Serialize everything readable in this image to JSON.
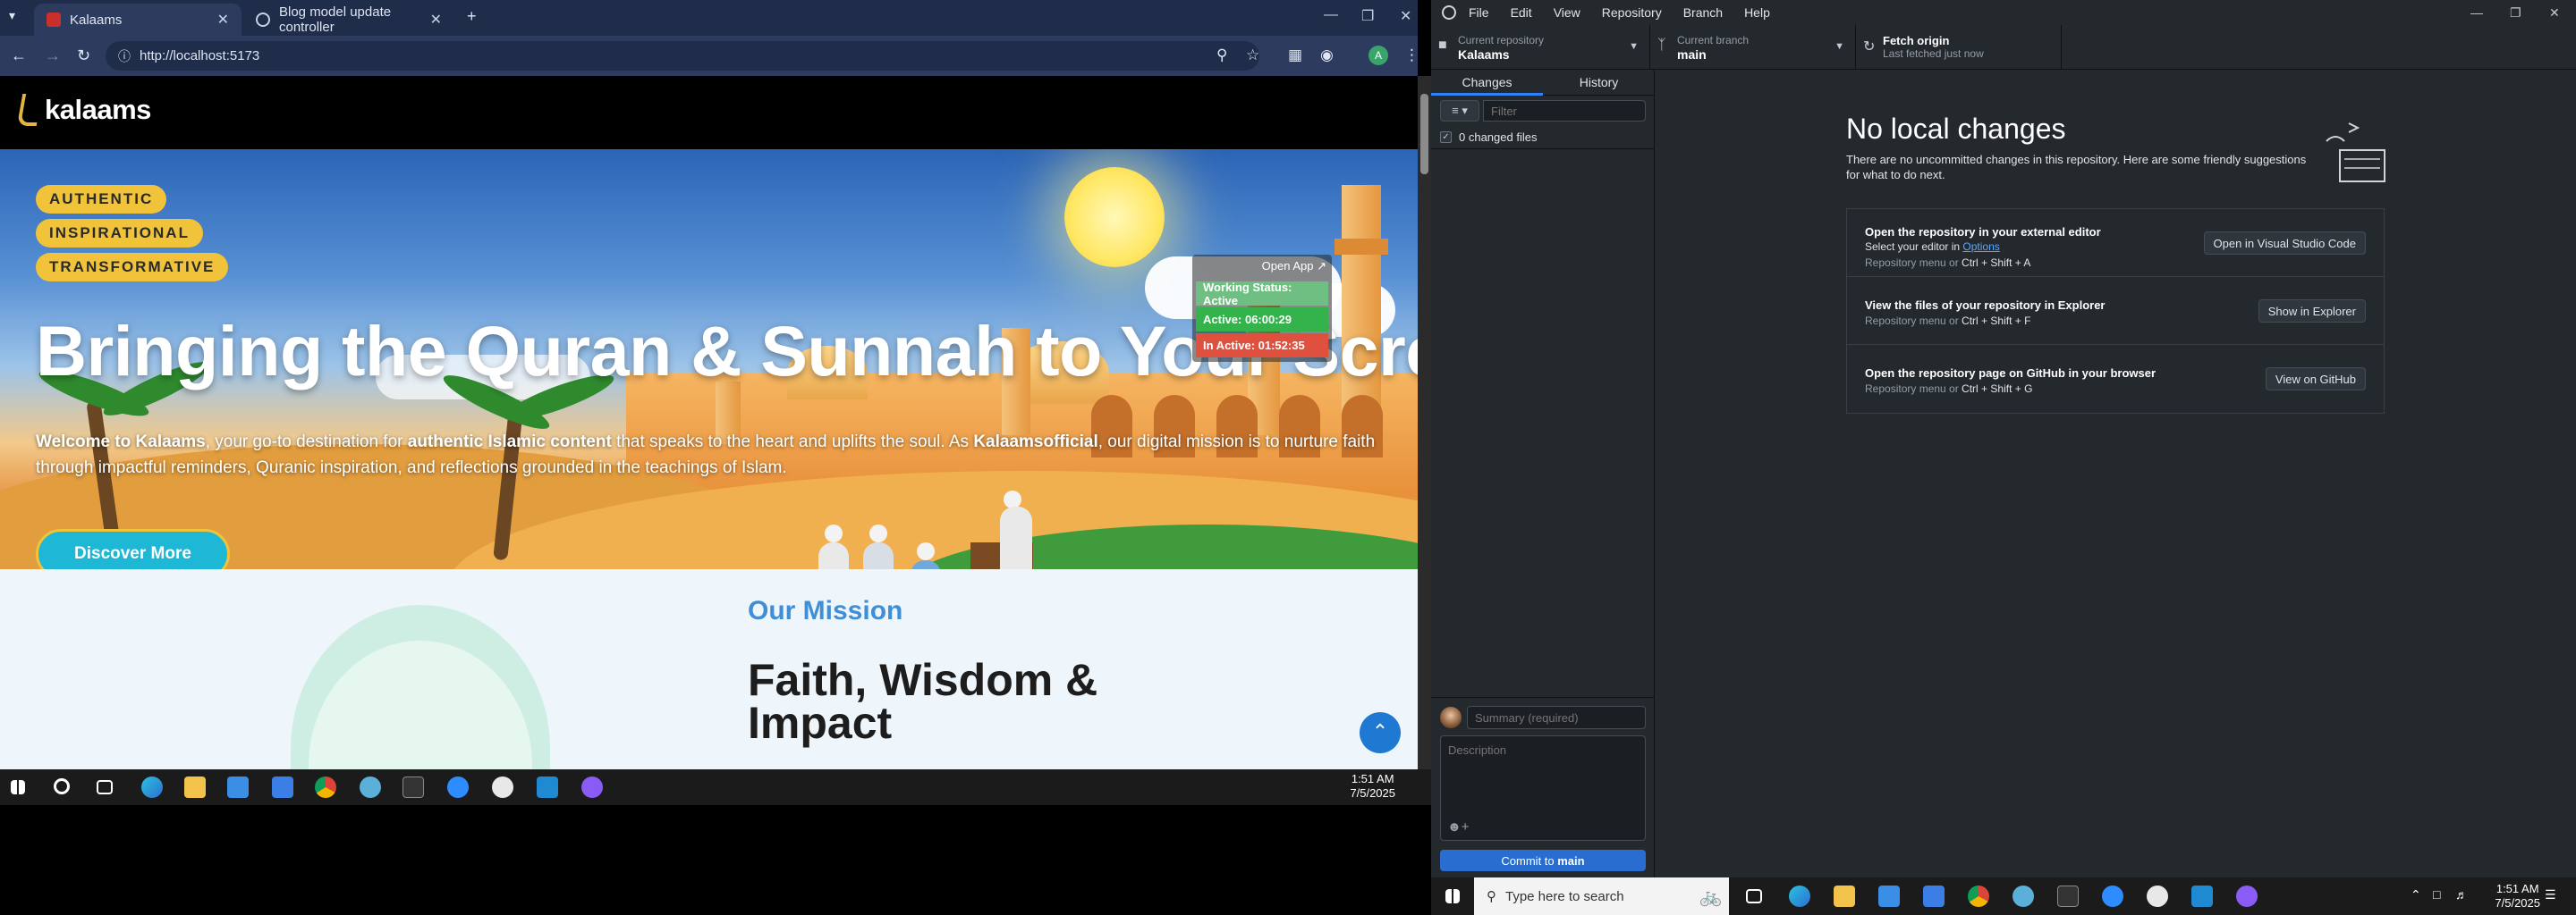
{
  "browser": {
    "tabs": [
      {
        "label": "Kalaams",
        "active": true
      },
      {
        "label": "Blog model update controller",
        "active": false
      }
    ],
    "url": "http://localhost:5173",
    "profile_initial": "A"
  },
  "site": {
    "logo_text": "kalaams",
    "pills": [
      "AUTHENTIC",
      "INSPIRATIONAL",
      "TRANSFORMATIVE"
    ],
    "hero_title": "Bringing the Quran & Sunnah to Your Screen",
    "hero_text": {
      "p1": "Welcome to Kalaams",
      "p2": ", your go-to destination for ",
      "p3": "authentic Islamic content",
      "p4": " that speaks to the heart and uplifts the soul. As ",
      "p5": "Kalaamsofficial",
      "p6": ", our digital mission is to nurture faith through impactful reminders, Quranic inspiration, and reflections grounded in the teachings of Islam."
    },
    "discover_label": "Discover More",
    "mission_label": "Our Mission",
    "mission_title": "Faith, Wisdom & Impact",
    "scroll_top_icon": "chevron-up-icon"
  },
  "tracker": {
    "open_label": "Open App ↗",
    "working": "Working Status: Active",
    "active": "Active: 06:00:29",
    "inactive": "In Active: 01:52:35",
    "colors": {
      "working": "#6fbf83",
      "active": "#34b24c",
      "inactive": "#e0503f"
    }
  },
  "left_taskbar": {
    "time": "1:51 AM",
    "date": "7/5/2025"
  },
  "github": {
    "menu": [
      "File",
      "Edit",
      "View",
      "Repository",
      "Branch",
      "Help"
    ],
    "repo_label": "Current repository",
    "repo_value": "Kalaams",
    "branch_label": "Current branch",
    "branch_value": "main",
    "fetch_label": "Fetch origin",
    "fetch_sub": "Last fetched just now",
    "tabs": [
      "Changes",
      "History"
    ],
    "filter_placeholder": "Filter",
    "changed_files": "0 changed files",
    "summary_placeholder": "Summary (required)",
    "description_placeholder": "Description",
    "commit_prefix": "Commit to ",
    "commit_branch": "main",
    "no_changes_title": "No local changes",
    "no_changes_sub": "There are no uncommitted changes in this repository. Here are some friendly suggestions for what to do next.",
    "suggestions": [
      {
        "title": "Open the repository in your external editor",
        "desc_prefix": "Select your editor in ",
        "desc_link": "Options",
        "hint": "Repository menu or ",
        "shortcut": "Ctrl + Shift + A",
        "button": "Open in Visual Studio Code"
      },
      {
        "title": "View the files of your repository in Explorer",
        "hint": "Repository menu or ",
        "shortcut": "Ctrl + Shift + F",
        "button": "Show in Explorer"
      },
      {
        "title": "Open the repository page on GitHub in your browser",
        "hint": "Repository menu or ",
        "shortcut": "Ctrl + Shift + G",
        "button": "View on GitHub"
      }
    ]
  },
  "right_taskbar": {
    "search_placeholder": "Type here to search",
    "time": "1:51 AM",
    "date": "7/5/2025"
  }
}
